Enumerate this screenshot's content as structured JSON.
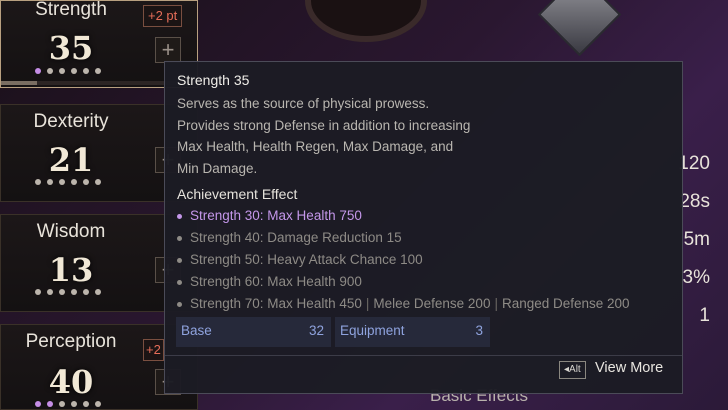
{
  "stats": [
    {
      "name": "Strength",
      "value": "35",
      "badge": "+2 pt",
      "dots_lit": 1
    },
    {
      "name": "Dexterity",
      "value": "21",
      "dots_lit": 0
    },
    {
      "name": "Wisdom",
      "value": "13",
      "dots_lit": 0
    },
    {
      "name": "Perception",
      "value": "40",
      "badge": "+2",
      "dots_lit": 2
    }
  ],
  "right_values": [
    "120",
    "28s",
    "5m",
    "3%",
    "1"
  ],
  "basic_effects_label": "Basic Effects",
  "tooltip": {
    "title": "Strength 35",
    "description": "Serves as the source of physical prowess. Provides strong Defense in addition to increasing Max Health, Health Regen, Max Damage, and Min Damage.",
    "achievement_title": "Achievement Effect",
    "achievements": [
      {
        "text": "Strength 30:  Max Health 750",
        "active": true
      },
      {
        "text": "Strength 40:  Damage Reduction 15",
        "active": false
      },
      {
        "text": "Strength 50:  Heavy Attack Chance 100",
        "active": false
      },
      {
        "text": "Strength 60:  Max Health 900",
        "active": false
      },
      {
        "text": "Strength 70:  Max Health 450",
        "extra": [
          "Melee Defense 200",
          "Ranged Defense 200"
        ],
        "active": false
      }
    ],
    "base_label": "Base",
    "base_value": "32",
    "equipment_label": "Equipment",
    "equipment_value": "3",
    "alt_key": "Alt",
    "view_more": "View More"
  },
  "colors": {
    "active_achievement": "#c497ea",
    "penalty_badge": "#e56d58",
    "box_text": "#8fa3de"
  }
}
